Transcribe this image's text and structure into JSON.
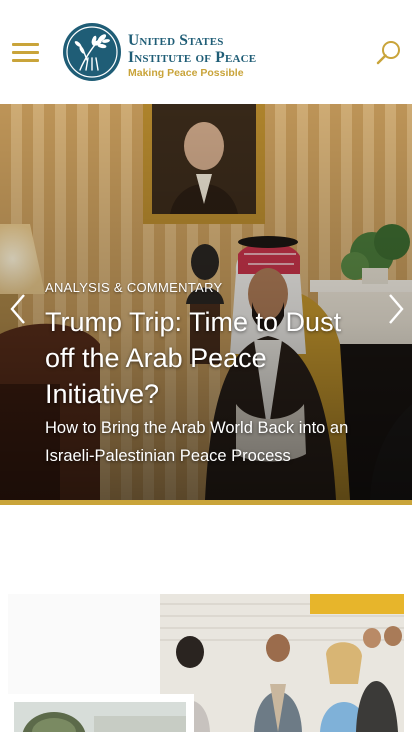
{
  "header": {
    "menu_icon": "hamburger-menu-icon",
    "logo": {
      "line1": "United States",
      "line2": "Institute of Peace",
      "tagline": "Making Peace Possible"
    },
    "search_icon": "search-icon"
  },
  "hero": {
    "category": "ANALYSIS & COMMENTARY",
    "title": "Trump Trip: Time to Dust off the Arab Peace Initiative?",
    "subtitle": "How to Bring the Arab World Back into an Israeli-Palestinian Peace Process",
    "prev_icon": "chevron-left-icon",
    "next_icon": "chevron-right-icon"
  },
  "colors": {
    "brand_blue": "#1f5d76",
    "brand_gold": "#c9a43a",
    "text_white": "#ffffff"
  }
}
